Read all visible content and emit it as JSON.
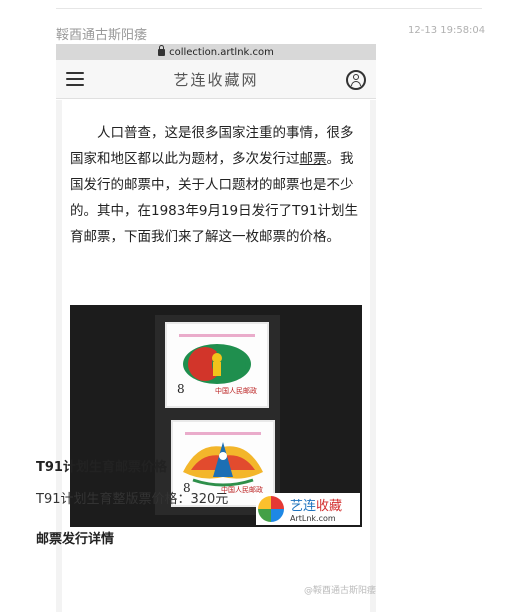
{
  "post": {
    "username": "鞖酉通古斯阳痿",
    "timestamp": "12-13 19:58:04"
  },
  "browser": {
    "url": "collection.artlnk.com"
  },
  "site": {
    "title": "艺连收藏网",
    "icons": [
      "menu-icon",
      "user-icon",
      "lock-icon"
    ]
  },
  "article": {
    "intro_before_link": "人口普查，这是很多国家注重的事情，很多国家和地区都以此为题材，多次发行过",
    "intro_link": "邮票",
    "intro_after_link": "。我国发行的邮票中，关于人口题材的邮票也是不少的。其中，在1983年9月19日发行了T91计划生育邮票，下面我们来了解这一枚邮票的价格。",
    "photo": {
      "stamp1_value": "8",
      "stamp1_caption": "中国人民邮政",
      "stamp2_value": "8",
      "stamp2_caption": "中国人民邮政",
      "watermark_cn_part1": "艺连",
      "watermark_cn_part2": "收藏",
      "watermark_en": "ArtLnk.com"
    },
    "section1_title": "T91计划生育邮票价格",
    "price_line": "T91计划生育整版票价格：320元",
    "section2_title": "邮票发行详情"
  },
  "overlay": {
    "weibo_watermark": "@鞖酉通古斯阳痿"
  }
}
